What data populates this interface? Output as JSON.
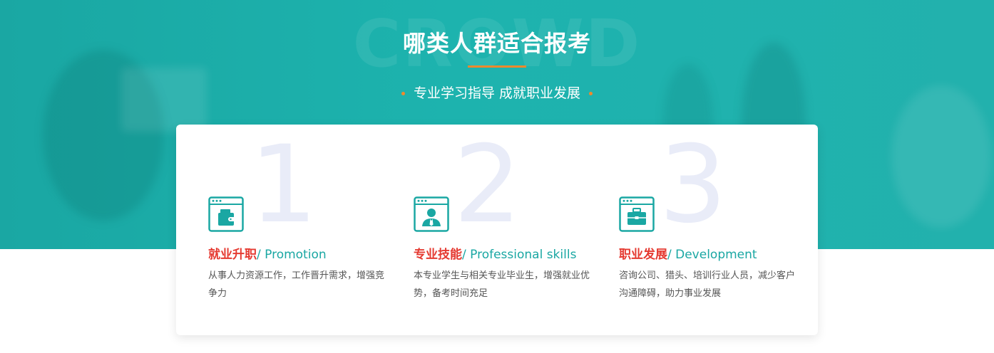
{
  "section": {
    "watermark": "CROWD",
    "title": "哪类人群适合报考",
    "subtitle": "专业学习指导 成就职业发展"
  },
  "colors": {
    "teal": "#1aa7a3",
    "accent_orange": "#f0892c",
    "heading_red": "#e53a31",
    "number_light": "#e9ecf8"
  },
  "items": [
    {
      "number": "1",
      "icon": "wallet-window-icon",
      "title_cn": "就业升职",
      "title_en": "/ Promotion",
      "desc": "从事人力资源工作，工作晋升需求，增强竞争力"
    },
    {
      "number": "2",
      "icon": "person-window-icon",
      "title_cn": "专业技能",
      "title_en": "/ Professional skills",
      "desc": "本专业学生与相关专业毕业生，增强就业优势，备考时间充足"
    },
    {
      "number": "3",
      "icon": "briefcase-window-icon",
      "title_cn": "职业发展",
      "title_en": "/ Development",
      "desc": "咨询公司、猎头、培训行业人员，减少客户沟通障碍，助力事业发展"
    }
  ]
}
